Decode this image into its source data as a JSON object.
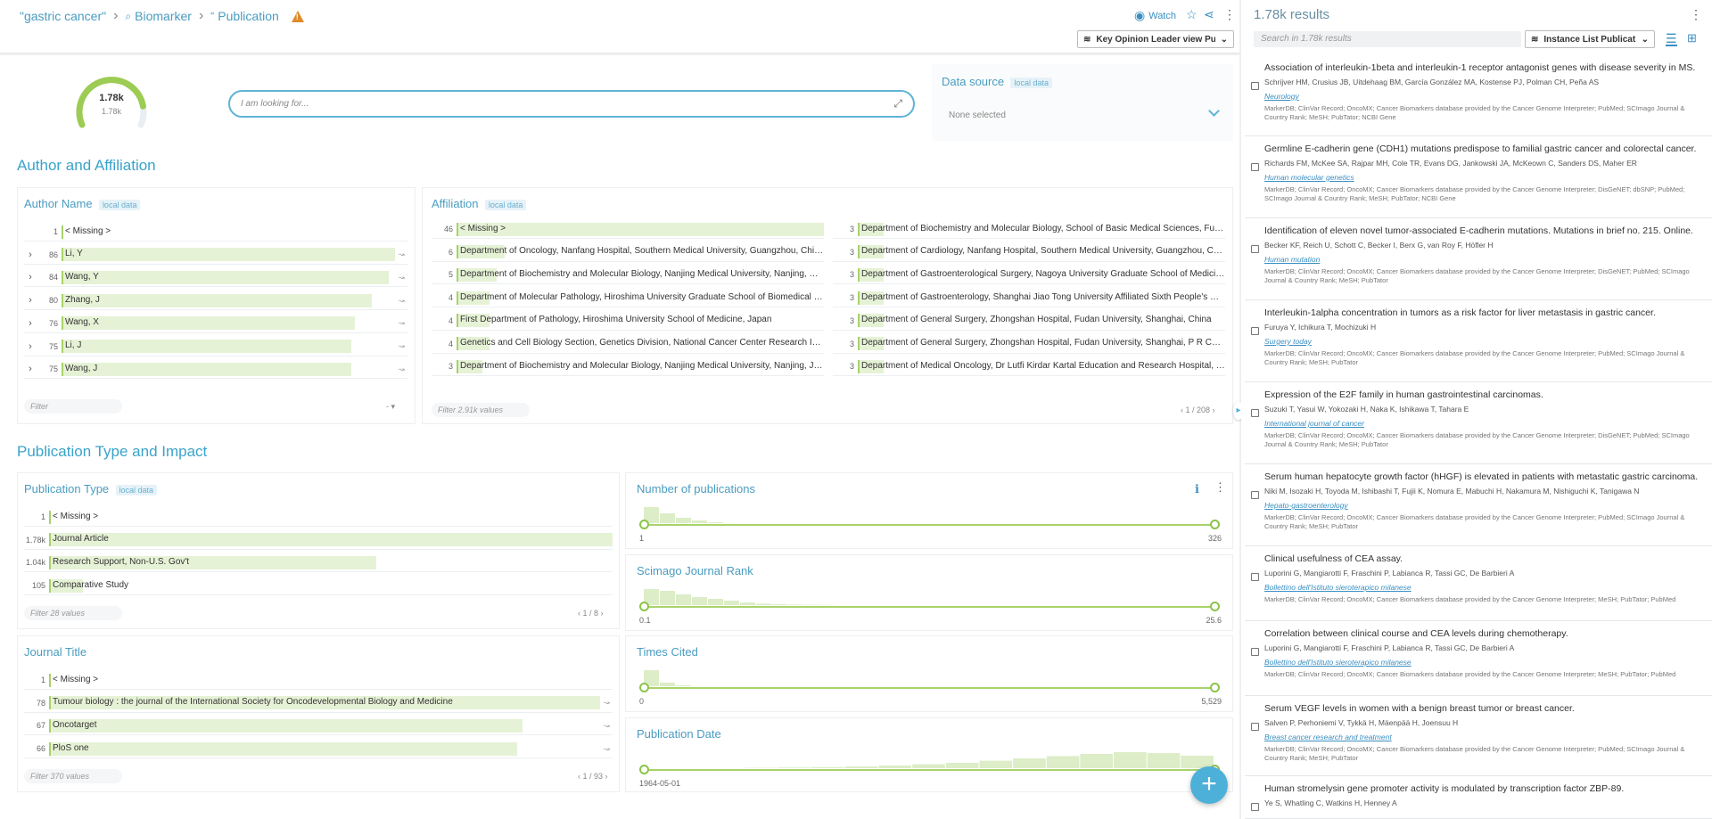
{
  "breadcrumb": {
    "query": "\"gastric cancer\"",
    "biomarker": "Biomarker",
    "publication": "Publication"
  },
  "toolbar": {
    "watch": "Watch",
    "kol_view": "Key Opinion Leader view Publ..."
  },
  "gauge": {
    "value": "1.78k",
    "sub": "1.78k",
    "fraction": 0.85
  },
  "search": {
    "placeholder": "I am looking for..."
  },
  "data_source": {
    "title": "Data source",
    "badge": "local data",
    "value": "None selected"
  },
  "sections": {
    "author_affiliation": "Author and Affiliation",
    "pub_type_impact": "Publication Type and Impact"
  },
  "author_name": {
    "title": "Author Name",
    "badge": "local data",
    "filter": "Filter",
    "rows": [
      {
        "count": "1",
        "label": "< Missing >",
        "fraction": 0.0,
        "expand": false
      },
      {
        "count": "86",
        "label": "Li, Y",
        "fraction": 1.0,
        "expand": true
      },
      {
        "count": "84",
        "label": "Wang, Y",
        "fraction": 0.98,
        "expand": true
      },
      {
        "count": "80",
        "label": "Zhang, J",
        "fraction": 0.93,
        "expand": true
      },
      {
        "count": "76",
        "label": "Wang, X",
        "fraction": 0.88,
        "expand": true
      },
      {
        "count": "75",
        "label": "Li, J",
        "fraction": 0.87,
        "expand": true
      },
      {
        "count": "75",
        "label": "Wang, J",
        "fraction": 0.87,
        "expand": true
      }
    ]
  },
  "affiliation": {
    "title": "Affiliation",
    "badge": "local data",
    "filter": "Filter 2.91k values",
    "pager": "1 / 208",
    "left": [
      {
        "count": "46",
        "label": "< Missing >",
        "fraction": 1.0
      },
      {
        "count": "6",
        "label": "Department of Oncology, Nanfang Hospital, Southern Medical University, Guangzhou, China",
        "fraction": 0.13
      },
      {
        "count": "5",
        "label": "Department of Biochemistry and Molecular Biology, Nanjing Medical University, Nanjing, Peopl...",
        "fraction": 0.11
      },
      {
        "count": "4",
        "label": "Department of Molecular Pathology, Hiroshima University Graduate School of Biomedical Scien...",
        "fraction": 0.09
      },
      {
        "count": "4",
        "label": "First Department of Pathology, Hiroshima University School of Medicine, Japan",
        "fraction": 0.09
      },
      {
        "count": "4",
        "label": "Genetics and Cell Biology Section, Genetics Division, National Cancer Center Research Institut...",
        "fraction": 0.09
      },
      {
        "count": "3",
        "label": "Department of Biochemistry and Molecular Biology, Nanjing Medical University, Nanjing, Jiangs...",
        "fraction": 0.07
      }
    ],
    "right": [
      {
        "count": "3",
        "label": "Department of Biochemistry and Molecular Biology, School of Basic Medical Sciences, Fudan U...",
        "fraction": 0.07
      },
      {
        "count": "3",
        "label": "Department of Cardiology, Nanfang Hospital, Southern Medical University, Guangzhou, China",
        "fraction": 0.07
      },
      {
        "count": "3",
        "label": "Department of Gastroenterological Surgery, Nagoya University Graduate School of Medicine, N...",
        "fraction": 0.07
      },
      {
        "count": "3",
        "label": "Department of Gastroenterology, Shanghai Jiao Tong University Affiliated Sixth People's Hospit...",
        "fraction": 0.07
      },
      {
        "count": "3",
        "label": "Department of General Surgery, Zhongshan Hospital, Fudan University, Shanghai, China",
        "fraction": 0.07
      },
      {
        "count": "3",
        "label": "Department of General Surgery, Zhongshan Hospital, Fudan University, Shanghai, P R China",
        "fraction": 0.07
      },
      {
        "count": "3",
        "label": "Department of Medical Oncology, Dr Lutfi Kirdar Kartal Education and Research Hospital, Istan...",
        "fraction": 0.07
      }
    ]
  },
  "publication_type": {
    "title": "Publication Type",
    "badge": "local data",
    "filter": "Filter 28 values",
    "pager": "1 / 8",
    "rows": [
      {
        "count": "1",
        "label": "< Missing >",
        "fraction": 0.0
      },
      {
        "count": "1.78k",
        "label": "Journal Article",
        "fraction": 1.0
      },
      {
        "count": "1.04k",
        "label": "Research Support, Non-U.S. Gov't",
        "fraction": 0.58
      },
      {
        "count": "105",
        "label": "Comparative Study",
        "fraction": 0.06
      }
    ]
  },
  "journal_title": {
    "title": "Journal Title",
    "filter": "Filter 370 values",
    "pager": "1 / 93",
    "rows": [
      {
        "count": "1",
        "label": "< Missing >",
        "fraction": 0.0
      },
      {
        "count": "78",
        "label": "Tumour biology : the journal of the International Society for Oncodevelopmental Biology and Medicine",
        "fraction": 1.0
      },
      {
        "count": "67",
        "label": "Oncotarget",
        "fraction": 0.86
      },
      {
        "count": "66",
        "label": "PloS one",
        "fraction": 0.85
      }
    ]
  },
  "histograms": [
    {
      "title": "Number of publications",
      "min": "1",
      "max": "326",
      "bins": [
        0.9,
        0.55,
        0.3,
        0.15,
        0.05,
        0,
        0,
        0,
        0,
        0
      ]
    },
    {
      "title": "Scimago Journal Rank",
      "min": "0.1",
      "max": "25.6",
      "bins": [
        0.9,
        0.8,
        0.6,
        0.45,
        0.35,
        0.25,
        0.15,
        0.08,
        0.05,
        0.03,
        0.02,
        0.01
      ]
    },
    {
      "title": "Times Cited",
      "min": "0",
      "max": "5,529",
      "bins": [
        0.9,
        0.2,
        0.05,
        0,
        0,
        0,
        0,
        0
      ]
    },
    {
      "title": "Publication Date",
      "min": "1964-05-01",
      "max": "20",
      "bins": [
        0,
        0,
        0,
        0.02,
        0.04,
        0.06,
        0.1,
        0.15,
        0.22,
        0.3,
        0.42,
        0.55,
        0.68,
        0.8,
        0.9,
        0.85,
        0.7
      ]
    }
  ],
  "results": {
    "title": "1.78k results",
    "search_placeholder": "Search in 1.78k results",
    "instance_list": "Instance List Publication",
    "items": [
      {
        "title": "Association of interleukin-1beta and interleukin-1 receptor antagonist genes with disease severity in MS.",
        "authors": "Schrijver HM, Crusius JB, Uitdehaag BM, García González MA, Kostense PJ, Polman CH, Peña AS",
        "journal": "Neurology",
        "sources": "MarkerDB; ClinVar Record; OncoMX; Cancer Biomarkers database provided by the Cancer Genome Interpreter; PubMed; SCImago Journal & Country Rank; MeSH; PubTator; NCBI Gene"
      },
      {
        "title": "Germline E-cadherin gene (CDH1) mutations predispose to familial gastric cancer and colorectal cancer.",
        "authors": "Richards FM, McKee SA, Rajpar MH, Cole TR, Evans DG, Jankowski JA, McKeown C, Sanders DS, Maher ER",
        "journal": "Human molecular genetics",
        "sources": "MarkerDB; ClinVar Record; OncoMX; Cancer Biomarkers database provided by the Cancer Genome Interpreter; DisGeNET; dbSNP; PubMed; SCImago Journal & Country Rank; MeSH; PubTator; NCBI Gene"
      },
      {
        "title": "Identification of eleven novel tumor-associated E-cadherin mutations. Mutations in brief no. 215. Online.",
        "authors": "Becker KF, Reich U, Schott C, Becker I, Berx G, van Roy F, Höfler H",
        "journal": "Human mutation",
        "sources": "MarkerDB; ClinVar Record; OncoMX; Cancer Biomarkers database provided by the Cancer Genome Interpreter; DisGeNET; PubMed; SCImago Journal & Country Rank; MeSH; PubTator"
      },
      {
        "title": "Interleukin-1alpha concentration in tumors as a risk factor for liver metastasis in gastric cancer.",
        "authors": "Furuya Y, Ichikura T, Mochizuki H",
        "journal": "Surgery today",
        "sources": "MarkerDB; ClinVar Record; OncoMX; Cancer Biomarkers database provided by the Cancer Genome Interpreter; PubMed; SCImago Journal & Country Rank; MeSH; PubTator"
      },
      {
        "title": "Expression of the E2F family in human gastrointestinal carcinomas.",
        "authors": "Suzuki T, Yasui W, Yokozaki H, Naka K, Ishikawa T, Tahara E",
        "journal": "International journal of cancer",
        "sources": "MarkerDB; ClinVar Record; OncoMX; Cancer Biomarkers database provided by the Cancer Genome Interpreter; DisGeNET; PubMed; SCImago Journal & Country Rank; MeSH; PubTator"
      },
      {
        "title": "Serum human hepatocyte growth factor (hHGF) is elevated in patients with metastatic gastric carcinoma.",
        "authors": "Niki M, Isozaki H, Toyoda M, Ishibashi T, Fujii K, Nomura E, Mabuchi H, Nakamura M, Nishiguchi K, Tanigawa N",
        "journal": "Hepato-gastroenterology",
        "sources": "MarkerDB; ClinVar Record; OncoMX; Cancer Biomarkers database provided by the Cancer Genome Interpreter; PubMed; SCImago Journal & Country Rank; MeSH; PubTator"
      },
      {
        "title": "Clinical usefulness of CEA assay.",
        "authors": "Luporini G, Mangiarotti F, Fraschini P, Labianca R, Tassi GC, De Barbieri A",
        "journal": "Bollettino dell'Istituto sieroterapico milanese",
        "sources": "MarkerDB; ClinVar Record; OncoMX; Cancer Biomarkers database provided by the Cancer Genome Interpreter; MeSH; PubTator; PubMed"
      },
      {
        "title": "Correlation between clinical course and CEA levels during chemotherapy.",
        "authors": "Luporini G, Mangiarotti F, Fraschini P, Labianca R, Tassi GC, De Barbieri A",
        "journal": "Bollettino dell'Istituto sieroterapico milanese",
        "sources": "MarkerDB; ClinVar Record; OncoMX; Cancer Biomarkers database provided by the Cancer Genome Interpreter; MeSH; PubTator; PubMed"
      },
      {
        "title": "Serum VEGF levels in women with a benign breast tumor or breast cancer.",
        "authors": "Salven P, Perhoniemi V, Tykkä H, Mäenpää H, Joensuu H",
        "journal": "Breast cancer research and treatment",
        "sources": "MarkerDB; ClinVar Record; OncoMX; Cancer Biomarkers database provided by the Cancer Genome Interpreter; PubMed; SCImago Journal & Country Rank; MeSH; PubTator"
      },
      {
        "title": "Human stromelysin gene promoter activity is modulated by transcription factor ZBP-89.",
        "authors": "Ye S, Whatling C, Watkins H, Henney A",
        "journal": "",
        "sources": ""
      }
    ]
  }
}
